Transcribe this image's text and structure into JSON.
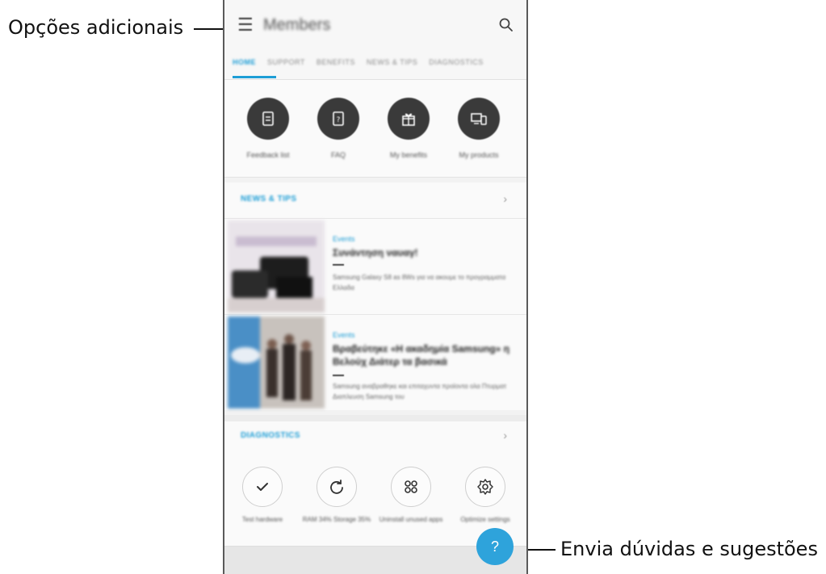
{
  "callouts": {
    "more_options": "Opções adicionais",
    "send_feedback": "Envia dúvidas e sugestões"
  },
  "app": {
    "title": "Members",
    "menu_icon": "hamburger-menu-icon",
    "search_icon": "search-icon"
  },
  "tabs": [
    {
      "label": "HOME",
      "active": true
    },
    {
      "label": "SUPPORT"
    },
    {
      "label": "BENEFITS"
    },
    {
      "label": "NEWS & TIPS"
    },
    {
      "label": "DIAGNOSTICS"
    }
  ],
  "quick_actions": [
    {
      "label": "Feedback list",
      "icon": "document-icon"
    },
    {
      "label": "FAQ",
      "icon": "faq-book-icon"
    },
    {
      "label": "My benefits",
      "icon": "gift-icon"
    },
    {
      "label": "My products",
      "icon": "devices-icon"
    }
  ],
  "news": {
    "title": "NEWS & TIPS",
    "articles": [
      {
        "category": "Events",
        "title": "Συνάντηση ναυαγ!",
        "description": "Samsung Galaxy S8 as 8Ws για να ακουμε το προγραμματα Ελλαδα"
      },
      {
        "category": "Events",
        "title": "Βραβεύτηκε «Η ακαδημία Samsung» η Βελούχ Διάτερ τα βασικά",
        "description": "Samsung αναβραθηκε και επιταχυντα προϊοντα ολα Πτυρματ Διαπλευση Samsung του"
      }
    ]
  },
  "diagnostics": {
    "title": "DIAGNOSTICS",
    "items": [
      {
        "label": "Test hardware",
        "icon": "checkmark-icon"
      },
      {
        "label": "RAM 34% Storage 35%",
        "icon": "refresh-icon"
      },
      {
        "label": "Uninstall unused apps",
        "icon": "apps-grid-icon"
      },
      {
        "label": "Optimize settings",
        "icon": "settings-gear-icon"
      }
    ]
  },
  "fab": {
    "label": "?",
    "icon": "question-icon"
  },
  "colors": {
    "accent": "#1e9ed6",
    "fab": "#2ea3db",
    "icon_dark": "#3a3a3a"
  }
}
